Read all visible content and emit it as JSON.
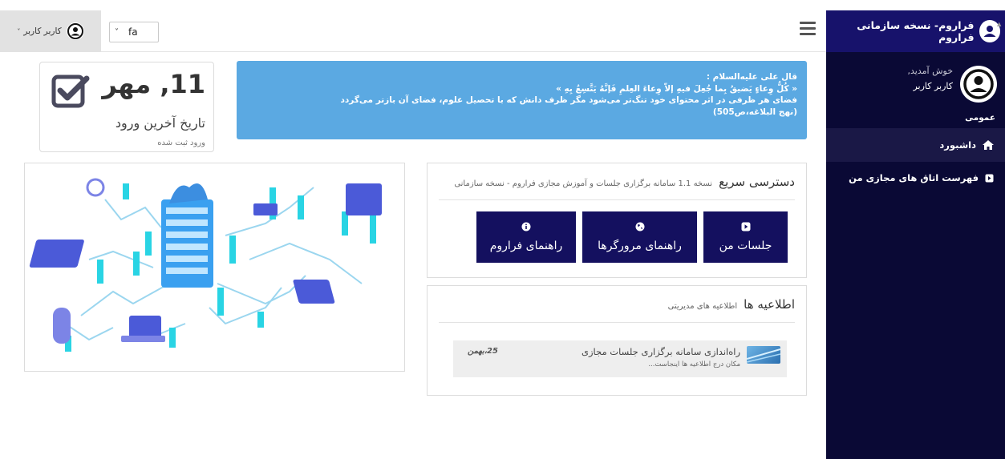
{
  "header": {
    "brand": "فراروم- نسخه سازمانی فراروم",
    "language": "fa",
    "user_name": "کاربر کاربر"
  },
  "sidebar": {
    "welcome": "خوش آمدید,",
    "user_name": "کاربر کاربر",
    "section_title": "عمومی",
    "items": [
      {
        "label": "داشبورد",
        "icon": "home-icon",
        "active": true
      },
      {
        "label": "فهرست اتاق های مجازی من",
        "icon": "play-square-icon",
        "active": false
      }
    ]
  },
  "quote": {
    "line1": "قال علی علیه‌السلام :",
    "line2": "« كُلُّ وِعاءٍ يَضيقُ بِما جُعِلَ فيهِ إلاّ وِعاءَ العِلمِ فَإنَّهُ يَتَّسِعُ بِهِ »",
    "line3": "فضای هر ظرفی در اثر محتوای خود تنگ‌تر می‌شود مگر ظرف دانش که با تحصیل علوم، فضای آن بازتر می‌گردد",
    "line4": "(نهج البلاغه،ص505)"
  },
  "last_login": {
    "date": "11, مهر",
    "label": "تاریخ آخرین ورود",
    "sub": "ورود ثبت شده"
  },
  "quick_access": {
    "title": "دسترسی سریع",
    "subtitle": "نسخه 1.1 سامانه برگزاری جلسات و آموزش مجازی فراروم - نسخه سازمانی",
    "buttons": [
      {
        "label": "جلسات من",
        "icon": "play-square-icon"
      },
      {
        "label": "راهنمای مرورگرها",
        "icon": "globe-icon"
      },
      {
        "label": "راهنمای فراروم",
        "icon": "info-icon"
      }
    ]
  },
  "announcements": {
    "title": "اطلاعیه ها",
    "subtitle": "اطلاعیه های مدیریتی",
    "items": [
      {
        "title": "راه‌اندازی سامانه برگزاری جلسات مجازی",
        "desc": "مکان درج اطلاعیه ها اینجاست...",
        "date": "25،بهمن"
      }
    ]
  },
  "colors": {
    "sidebar_bg": "#0a0935",
    "sidebar_header_bg": "#17126b",
    "quote_bg": "#5ba9e2",
    "button_bg": "#14105f"
  }
}
